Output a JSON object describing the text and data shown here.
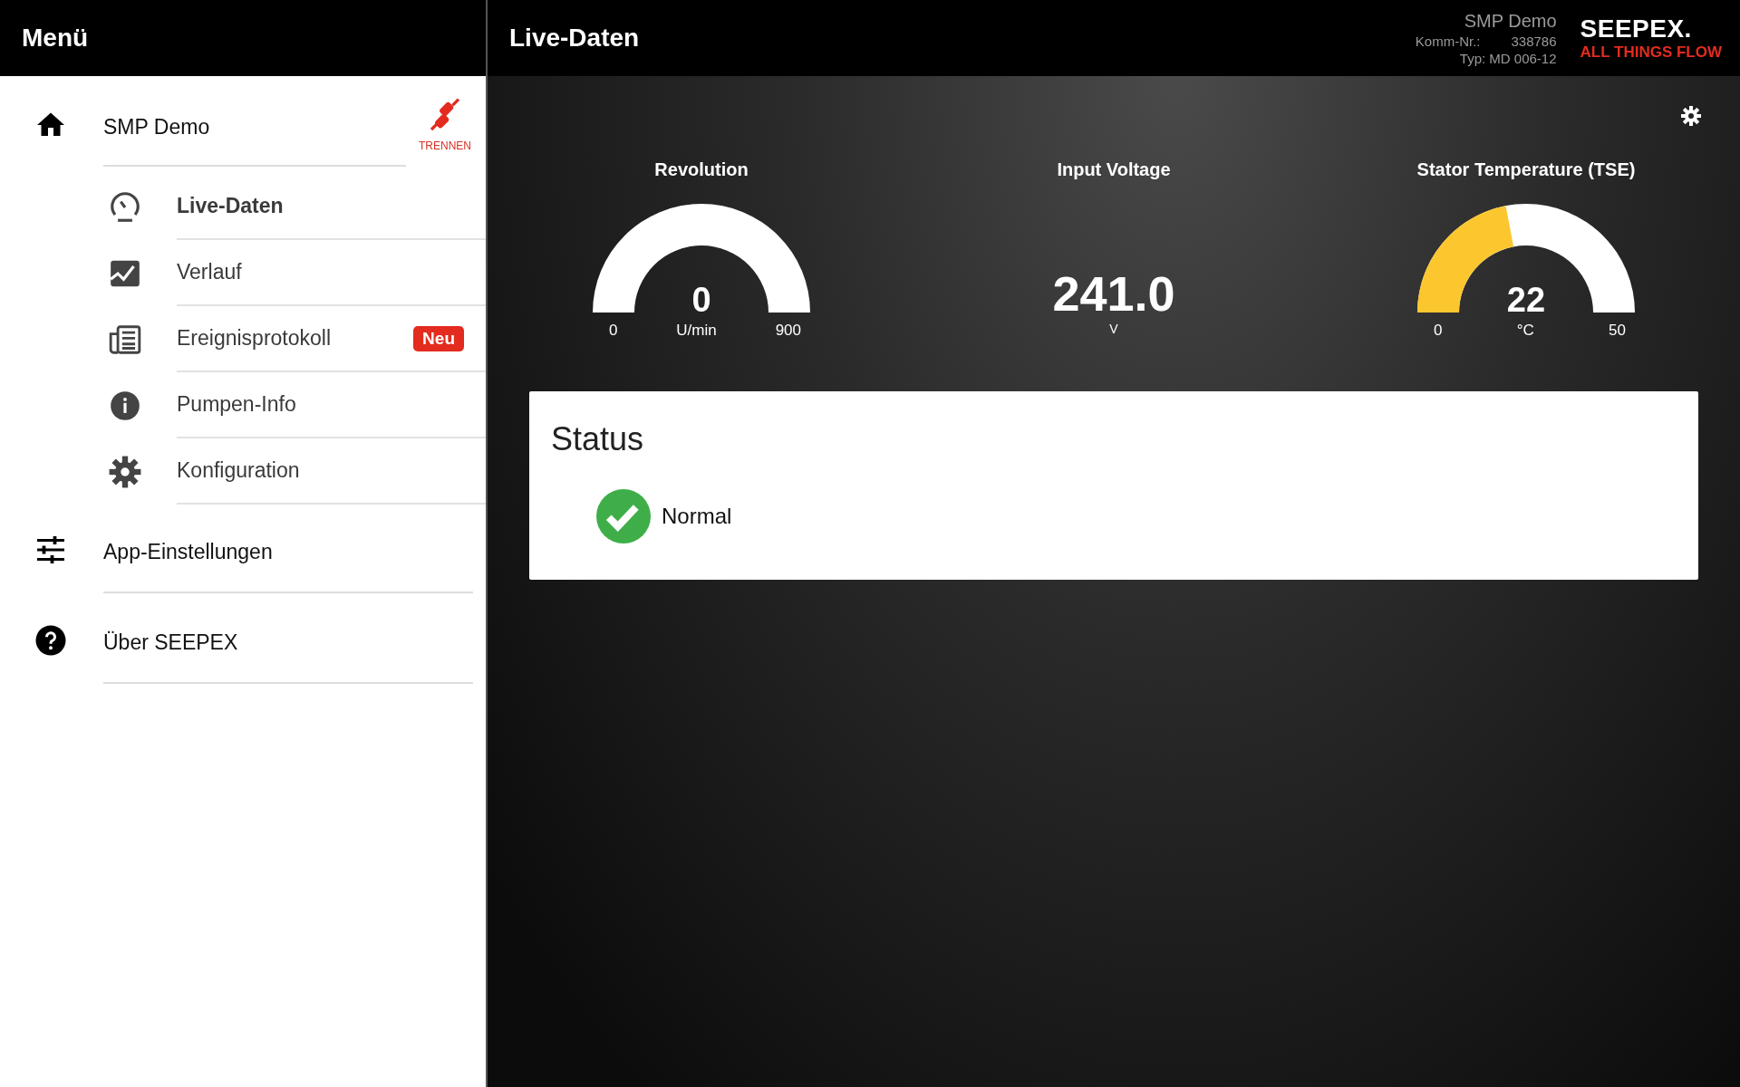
{
  "sidebar": {
    "title": "Menü",
    "device": {
      "name": "SMP Demo",
      "disconnect_label": "TRENNEN"
    },
    "items": [
      {
        "label": "Live-Daten",
        "selected": true
      },
      {
        "label": "Verlauf",
        "selected": false
      },
      {
        "label": "Ereignisprotokoll",
        "selected": false,
        "badge": "Neu"
      },
      {
        "label": "Pumpen-Info",
        "selected": false
      },
      {
        "label": "Konfiguration",
        "selected": false
      }
    ],
    "footer_items": [
      {
        "label": "App-Einstellungen"
      },
      {
        "label": "Über SEEPEX"
      }
    ]
  },
  "header": {
    "title": "Live-Daten",
    "device_name": "SMP Demo",
    "komm_label": "Komm-Nr.:",
    "komm_value": "338786",
    "type": "Typ: MD 006-12",
    "logo": "SEEPEX.",
    "tagline": "ALL THINGS FLOW"
  },
  "gauges": [
    {
      "kind": "gauge",
      "title": "Revolution",
      "value": "0",
      "unit": "U/min",
      "min": "0",
      "max": "900",
      "level": 0
    },
    {
      "kind": "value",
      "title": "Input Voltage",
      "value": "241.0",
      "unit": "V"
    },
    {
      "kind": "gauge",
      "title": "Stator Temperature (TSE)",
      "value": "22",
      "unit": "°C",
      "min": "0",
      "max": "50",
      "level": 0.44
    }
  ],
  "status": {
    "title": "Status",
    "label": "Normal"
  }
}
